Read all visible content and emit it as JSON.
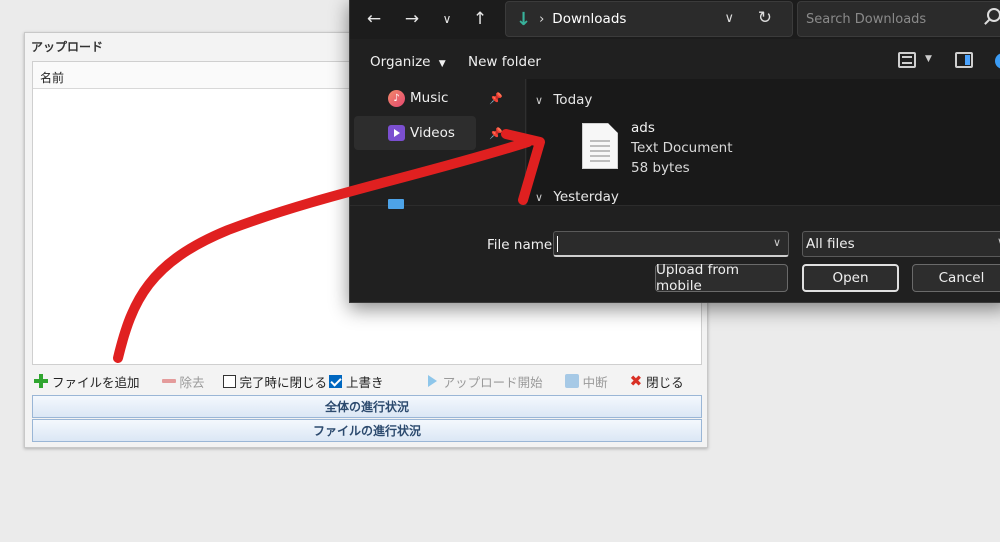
{
  "upload": {
    "title": "アップロード",
    "column_name": "名前",
    "toolbar": {
      "add_files": "ファイルを追加",
      "remove": "除去",
      "close_on_complete": "完了時に閉じる",
      "close_on_complete_checked": false,
      "overwrite": "上書き",
      "overwrite_checked": true,
      "start_upload": "アップロード開始",
      "abort": "中断",
      "close": "閉じる"
    },
    "overall_progress": "全体の進行状況",
    "file_progress": "ファイルの進行状況"
  },
  "dialog": {
    "breadcrumb": "Downloads",
    "search_placeholder": "Search Downloads",
    "organize": "Organize",
    "new_folder": "New folder",
    "nav": {
      "items": [
        {
          "label": "Music",
          "icon": "music-icon",
          "pinned": true
        },
        {
          "label": "Videos",
          "icon": "videos-icon",
          "pinned": true,
          "selected": true
        }
      ],
      "this_pc": "This PC"
    },
    "groups": [
      {
        "label": "Today"
      },
      {
        "label": "Yesterday"
      }
    ],
    "file": {
      "name": "ads",
      "type": "Text Document",
      "size": "58 bytes"
    },
    "file_name_label": "File name:",
    "file_name_value": "",
    "filter": "All files",
    "buttons": {
      "upload_mobile": "Upload from mobile",
      "open": "Open",
      "cancel": "Cancel"
    }
  },
  "colors": {
    "annotation_arrow": "#e02020",
    "dialog_bg": "#202020",
    "accent": "#0067c0"
  }
}
